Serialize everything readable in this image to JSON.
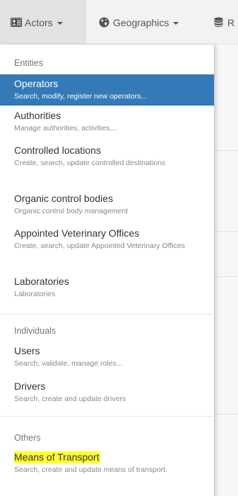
{
  "navbar": {
    "actors_label": "Actors",
    "geographics_label": "Geographics",
    "more_label": "R"
  },
  "dropdown": {
    "sections": [
      {
        "header": "Entities",
        "items": [
          {
            "title": "Operators",
            "desc": "Search, modify, register new operators..."
          },
          {
            "title": "Authorities",
            "desc": "Manage authorities, activities,..."
          },
          {
            "title": "Controlled locations",
            "desc": "Create, search, update controlled destinations"
          },
          {
            "title": "Organic control bodies",
            "desc": "Organic control body management"
          },
          {
            "title": "Appointed Veterinary Offices",
            "desc": "Create, search, update Appointed Veterinary Offices"
          },
          {
            "title": "Laboratories",
            "desc": "Laboratories"
          }
        ]
      },
      {
        "header": "Individuals",
        "items": [
          {
            "title": "Users",
            "desc": "Search, validate, manage roles..."
          },
          {
            "title": "Drivers",
            "desc": "Search, create and update drivers"
          }
        ]
      },
      {
        "header": "Others",
        "items": [
          {
            "title": "Means of Transport",
            "desc": "Search, create and update means of transport."
          }
        ]
      }
    ]
  },
  "colors": {
    "active_bg": "#337ab7",
    "highlight": "#ffff33",
    "navbar_bg": "#f2f2f2"
  },
  "icons": {
    "actors": "id-card-icon",
    "geographics": "globe-icon",
    "more": "database-icon"
  }
}
